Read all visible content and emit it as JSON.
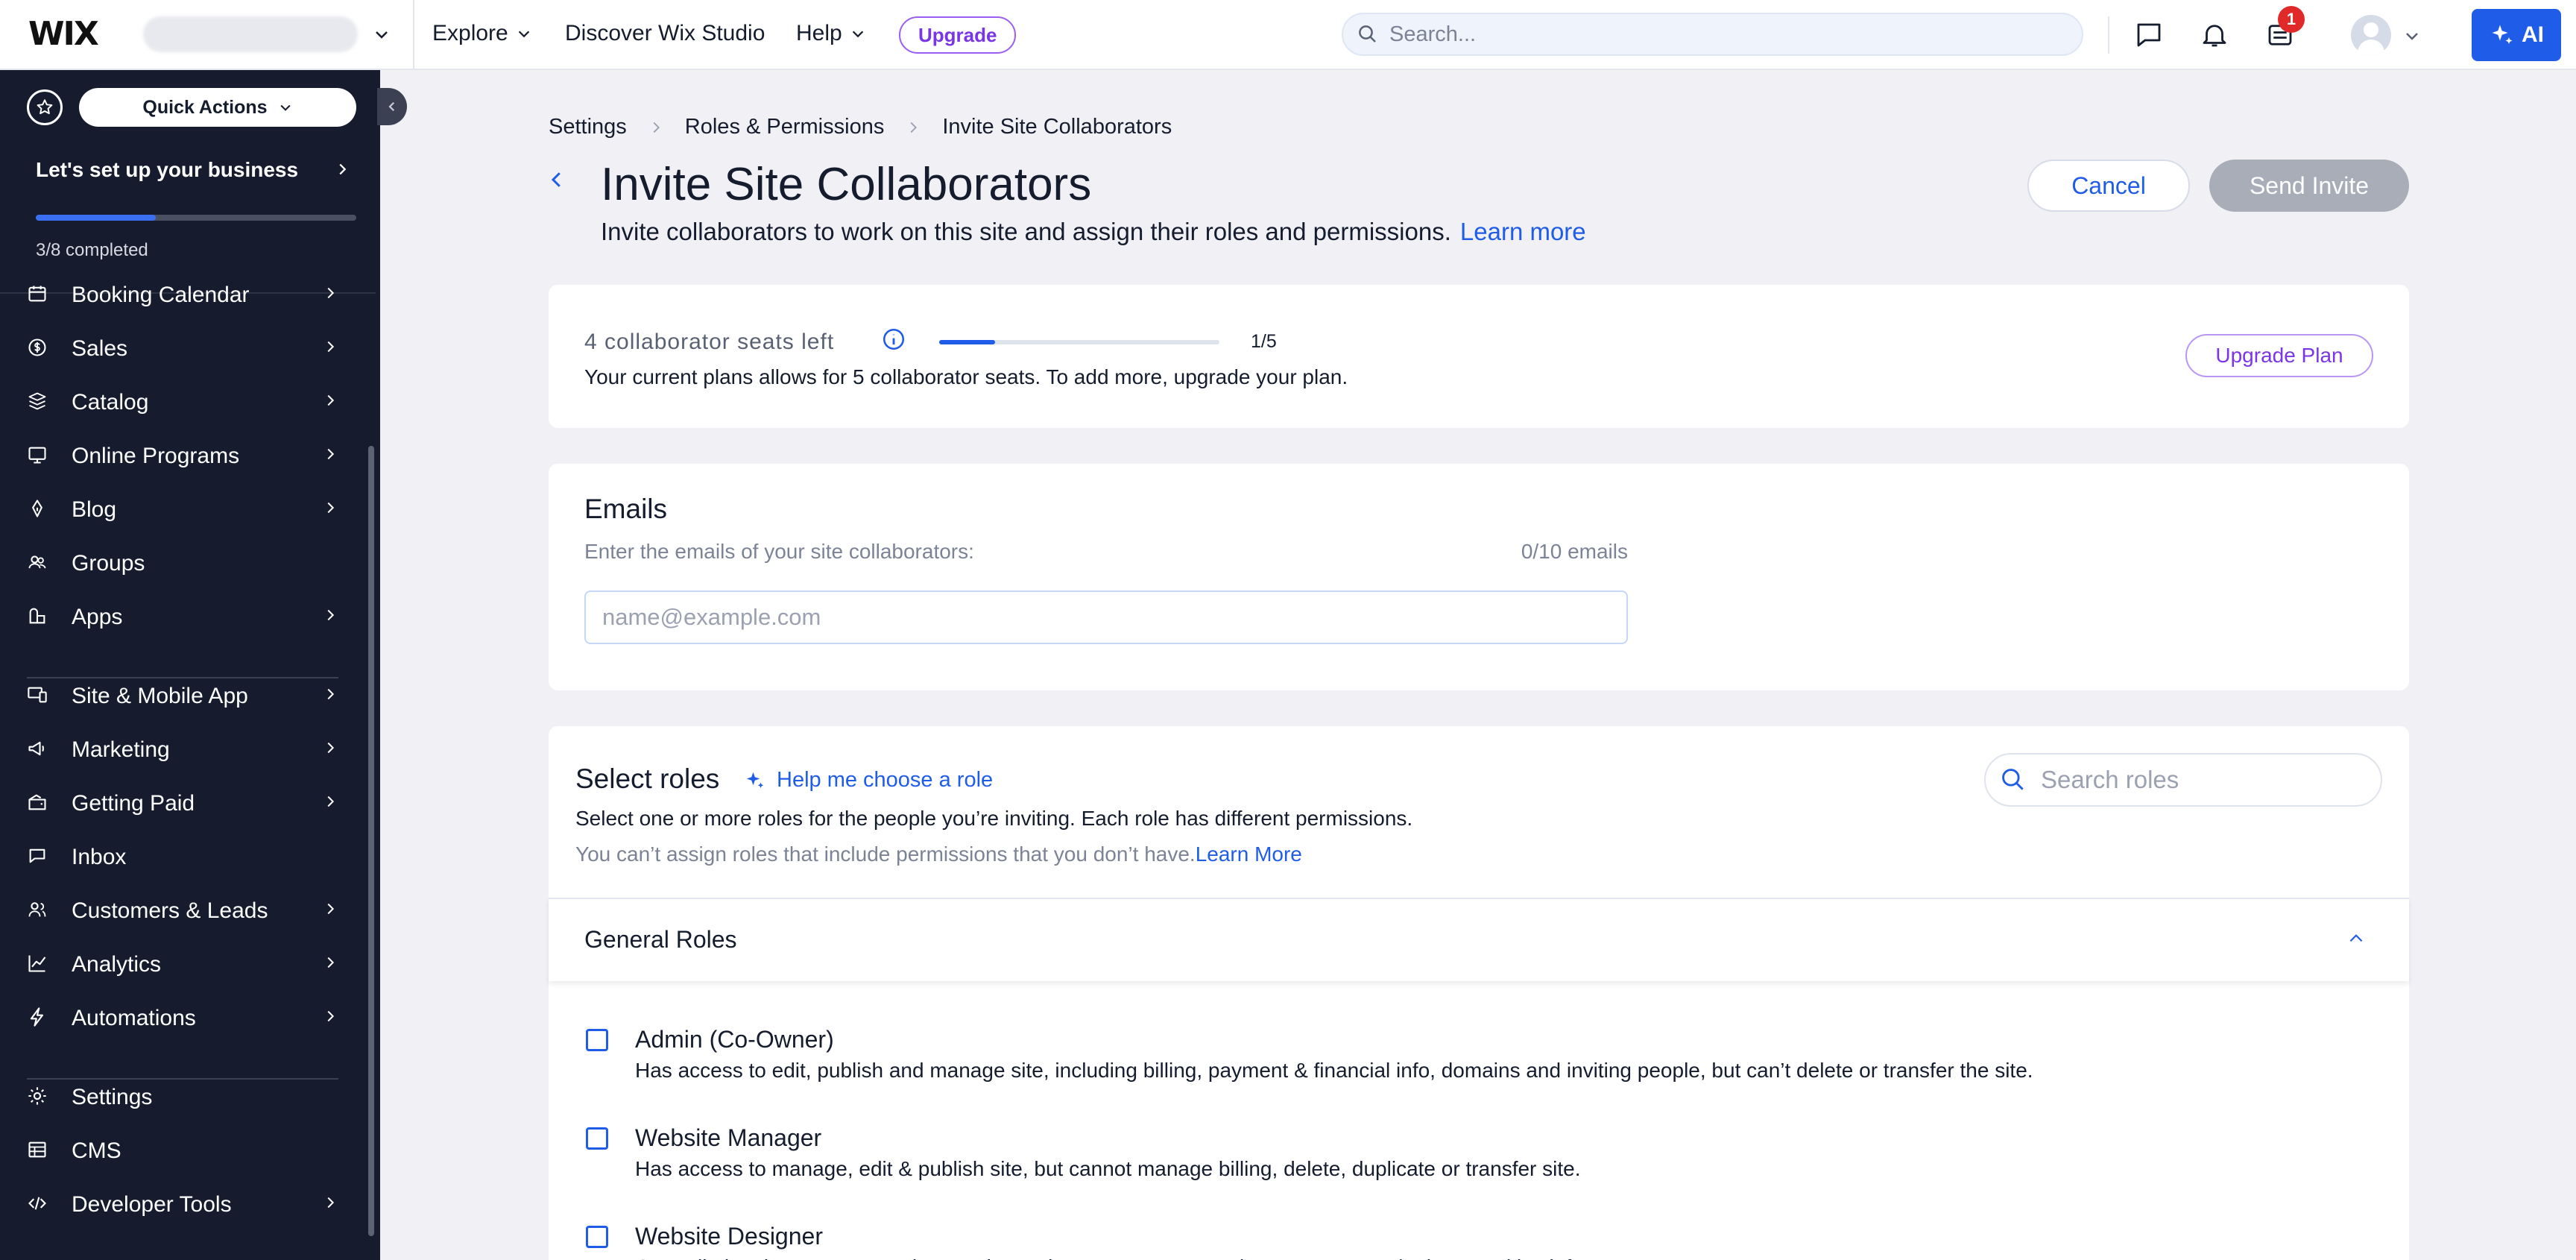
{
  "topbar": {
    "logo": "WIX",
    "nav": [
      "Explore",
      "Discover Wix Studio",
      "Help"
    ],
    "upgrade_label": "Upgrade",
    "search_placeholder": "Search...",
    "notification_count": "1",
    "ai_label": "AI",
    "icons": [
      "chat-icon",
      "bell-icon",
      "inbox-icon",
      "avatar",
      "sparkle-icon"
    ]
  },
  "sidebar": {
    "quick_actions_label": "Quick Actions",
    "setup": {
      "title": "Let's set up your business",
      "status": "3/8 completed",
      "progress": 0.375
    },
    "items": [
      {
        "label": "Booking Calendar",
        "icon": "calendar-icon",
        "arrow": true
      },
      {
        "label": "Sales",
        "icon": "dollar-icon",
        "arrow": true
      },
      {
        "label": "Catalog",
        "icon": "catalog-icon",
        "arrow": true
      },
      {
        "label": "Online Programs",
        "icon": "programs-icon",
        "arrow": true
      },
      {
        "label": "Blog",
        "icon": "pen-icon",
        "arrow": true
      },
      {
        "label": "Groups",
        "icon": "groups-icon",
        "arrow": false
      },
      {
        "label": "Apps",
        "icon": "apps-icon",
        "arrow": true
      },
      {
        "label": "Site & Mobile App",
        "icon": "devices-icon",
        "arrow": true
      },
      {
        "label": "Marketing",
        "icon": "megaphone-icon",
        "arrow": true
      },
      {
        "label": "Getting Paid",
        "icon": "wallet-icon",
        "arrow": true
      },
      {
        "label": "Inbox",
        "icon": "inbox-icon",
        "arrow": false
      },
      {
        "label": "Customers & Leads",
        "icon": "customers-icon",
        "arrow": true
      },
      {
        "label": "Analytics",
        "icon": "analytics-icon",
        "arrow": true
      },
      {
        "label": "Automations",
        "icon": "bolt-icon",
        "arrow": true
      },
      {
        "label": "Settings",
        "icon": "gear-icon",
        "arrow": false
      },
      {
        "label": "CMS",
        "icon": "table-icon",
        "arrow": false
      },
      {
        "label": "Developer Tools",
        "icon": "code-icon",
        "arrow": true
      }
    ]
  },
  "breadcrumb": [
    "Settings",
    "Roles & Permissions",
    "Invite Site Collaborators"
  ],
  "page": {
    "title": "Invite Site Collaborators",
    "subtitle": "Invite collaborators to work on this site and assign their roles and permissions.",
    "learn_more": "Learn more",
    "cancel_label": "Cancel",
    "send_label": "Send Invite"
  },
  "seats": {
    "label": "4 collaborator seats left",
    "used": 1,
    "total": 5,
    "count_text": "1/5",
    "description": "Your current plans allows for 5 collaborator seats. To add more, upgrade your plan.",
    "upgrade_label": "Upgrade Plan"
  },
  "emails": {
    "title": "Emails",
    "hint": "Enter the emails of your site collaborators:",
    "count": "0/10 emails",
    "value": "",
    "placeholder": "name@example.com"
  },
  "roles": {
    "title": "Select roles",
    "help_label": "Help me choose a role",
    "search_placeholder": "Search roles",
    "description": "Select one or more roles for the people you’re inviting. Each role has different permissions.",
    "note": "You can’t assign roles that include permissions that you don’t have.",
    "note_link": "Learn More",
    "general_title": "General Roles",
    "items": [
      {
        "name": "Admin (Co-Owner)",
        "desc": "Has access to edit, publish and manage site, including billing, payment & financial info, domains and inviting people, but can’t delete or transfer the site.",
        "checked": false
      },
      {
        "name": "Website Manager",
        "desc": "Has access to manage, edit & publish site, but cannot manage billing, delete, duplicate or transfer site.",
        "checked": false
      },
      {
        "name": "Website Designer",
        "desc": "Can edit the site, manage settings and apps but cannot access Inbox, contacts and other sensitive info.",
        "checked": false
      }
    ]
  },
  "colors": {
    "sidebar_bg": "#161c2d",
    "accent": "#1f5ce8",
    "upgrade_purple": "#7a35e6",
    "badge_red": "#e02a2a",
    "disabled_button": "#a8adb8"
  }
}
